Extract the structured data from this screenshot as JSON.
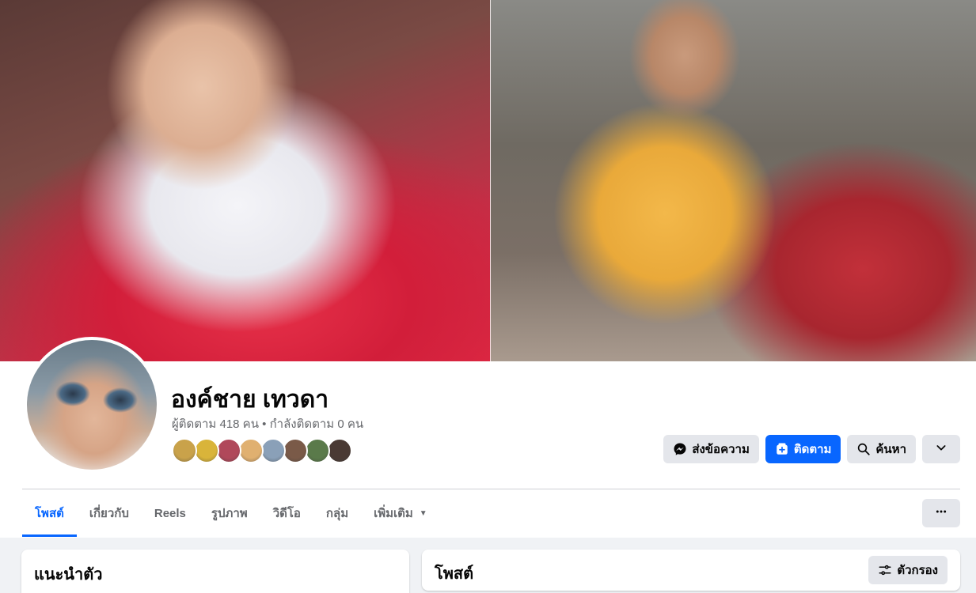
{
  "profile": {
    "name": "องค์ชาย เทวดา",
    "followers_text": "ผู้ติดตาม 418 คน",
    "separator": "•",
    "following_text": "กำลังติดตาม 0 คน"
  },
  "friends_avatars": [
    {
      "color": "#c9a24a"
    },
    {
      "color": "#d9b43a"
    },
    {
      "color": "#b0485a"
    },
    {
      "color": "#e0b070"
    },
    {
      "color": "#8aa0b8"
    },
    {
      "color": "#7a5a48"
    },
    {
      "color": "#5a7a4a"
    },
    {
      "color": "#4a3a34"
    }
  ],
  "actions": {
    "message_label": "ส่งข้อความ",
    "follow_label": "ติดตาม",
    "search_label": "ค้นหา"
  },
  "tabs": [
    {
      "label": "โพสต์",
      "active": true
    },
    {
      "label": "เกี่ยวกับ"
    },
    {
      "label": "Reels"
    },
    {
      "label": "รูปภาพ"
    },
    {
      "label": "วิดีโอ"
    },
    {
      "label": "กลุ่ม"
    },
    {
      "label": "เพิ่มเติม"
    }
  ],
  "intro": {
    "title": "แนะนำตัว"
  },
  "posts": {
    "title": "โพสต์",
    "filter_label": "ตัวกรอง"
  },
  "colors": {
    "accent": "#0866ff",
    "button_gray": "#e4e6eb",
    "muted_text": "#65676b"
  }
}
